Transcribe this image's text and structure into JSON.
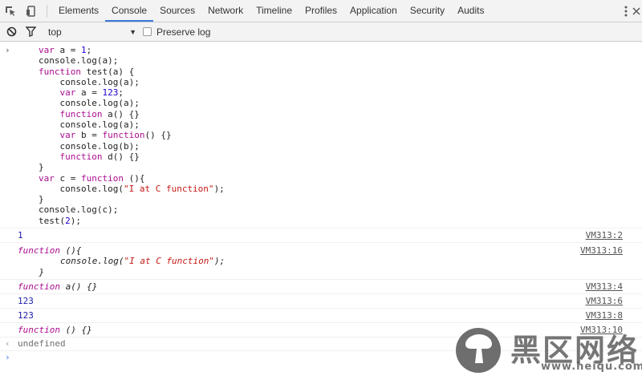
{
  "tabbar": {
    "tabs": [
      {
        "label": "Elements",
        "active": false
      },
      {
        "label": "Console",
        "active": true
      },
      {
        "label": "Sources",
        "active": false
      },
      {
        "label": "Network",
        "active": false
      },
      {
        "label": "Timeline",
        "active": false
      },
      {
        "label": "Profiles",
        "active": false
      },
      {
        "label": "Application",
        "active": false
      },
      {
        "label": "Security",
        "active": false
      },
      {
        "label": "Audits",
        "active": false
      }
    ],
    "icons": [
      "inspect-icon",
      "device-toggle-icon",
      "more-menu-icon",
      "close-icon"
    ]
  },
  "filterbar": {
    "context": "top",
    "preserve_log": "Preserve log",
    "preserve_checked": false
  },
  "console": {
    "input_lines": [
      "var a = 1;",
      "console.log(a);",
      "function test(a) {",
      "    console.log(a);",
      "    var a = 123;",
      "    console.log(a);",
      "    function a() {}",
      "    console.log(a);",
      "    var b = function() {}",
      "    console.log(b);",
      "    function d() {}",
      "}",
      "var c = function (){",
      "    console.log(\"I at C function\");",
      "}",
      "console.log(c);",
      "test(2);"
    ],
    "outputs": [
      {
        "text": "1",
        "source": "VM313:2"
      },
      {
        "lines": [
          "function (){",
          "        console.log(\"I at C function\");",
          "    }"
        ],
        "source": "VM313:16"
      },
      {
        "text": "function a() {}",
        "source": "VM313:4"
      },
      {
        "text": "123",
        "source": "VM313:6"
      },
      {
        "text": "123",
        "source": "VM313:8"
      },
      {
        "text": "function () {}",
        "source": "VM313:10"
      }
    ],
    "result": "undefined"
  },
  "watermark": {
    "text": "黑区网络",
    "url": "www.heiqu.com"
  }
}
